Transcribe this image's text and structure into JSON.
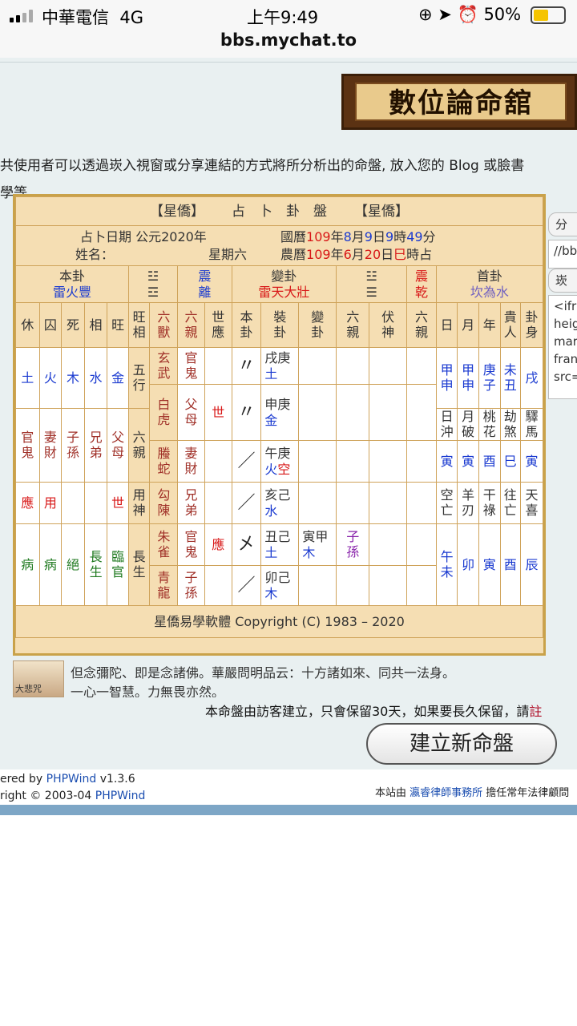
{
  "status": {
    "carrier": "中華電信",
    "network": "4G",
    "time": "上午9:49",
    "battery": "50%",
    "url": "bbs.mychat.to"
  },
  "banner": {
    "title": "數位論命舘"
  },
  "intro": {
    "line1": "共使用者可以透過崁入視窗或分享連結的方式將所分析出的命盤, 放入您的 Blog 或臉書",
    "line2": "學等."
  },
  "side": {
    "share_label": "分",
    "link_text": "//bb",
    "embed_label": "崁",
    "code_lines": [
      "<ifra",
      "heig",
      "mar",
      "fran",
      "src="
    ]
  },
  "chart": {
    "title_left": "【星僑】",
    "title_main": "占　卜　卦　盤",
    "title_right": "【星僑】",
    "date_label": "占卜日期 公元2020年",
    "name_label": "姓名：",
    "weekday": "星期六",
    "greg": {
      "p1": "國曆",
      "y": "109",
      "p2": "年",
      "m": "8",
      "p3": "月",
      "d": "9",
      "p4": "日",
      "h": "9",
      "p5": "時",
      "mi": "49",
      "p6": "分"
    },
    "lunar": {
      "p1": "農曆",
      "y": "109",
      "p2": "年",
      "m": "6",
      "p3": "月",
      "d": "20",
      "p4": "日",
      "h": "巳",
      "p5": "時占"
    },
    "ben_label": "本卦",
    "ben_name": "雷火豐",
    "tri1_top": "☳",
    "tri1_bot": "☲",
    "tri1_top_name": "震",
    "tri1_bot_name": "離",
    "bian_label": "變卦",
    "bian_name": "雷天大壯",
    "tri2_top": "☳",
    "tri2_bot": "☰",
    "tri2_top_name": "震",
    "tri2_bot_name": "乾",
    "shou_label": "首卦",
    "shou_name": "坎為水",
    "wang": [
      "休",
      "囚",
      "死",
      "相",
      "旺"
    ],
    "wang_label": "旺相",
    "wuxing": [
      "土",
      "火",
      "木",
      "水",
      "金"
    ],
    "wuxing_label": "五行",
    "liuqin_row": [
      "官鬼",
      "妻財",
      "子孫",
      "兄弟",
      "父母"
    ],
    "liuqin_label": "六親",
    "yong": [
      "應",
      "用",
      "",
      "",
      "世"
    ],
    "yong_label": "用神",
    "changsheng": [
      "病",
      "病",
      "絕",
      "長生",
      "臨官"
    ],
    "changsheng_label": "長生",
    "col_heads": [
      "六獸",
      "六親",
      "世應",
      "本卦",
      "裝卦",
      "變卦",
      "六親",
      "伏神",
      "六親"
    ],
    "lines": [
      {
        "shou": "玄武",
        "qin": "官鬼",
        "shi": "",
        "yao": "〃",
        "zhuang1": "戌庚",
        "zhuang2": "土",
        "bian1": "",
        "bian2": "",
        "q2": ""
      },
      {
        "shou": "白虎",
        "qin": "父母",
        "shi": "世",
        "yao": "〃",
        "zhuang1": "申庚",
        "zhuang2": "金",
        "bian1": "",
        "bian2": "",
        "q2": ""
      },
      {
        "shou": "螣蛇",
        "qin": "妻財",
        "shi": "",
        "yao": "／",
        "zhuang1": "午庚",
        "zhuang2": "火空",
        "bian1": "",
        "bian2": "",
        "q2": ""
      },
      {
        "shou": "勾陳",
        "qin": "兄弟",
        "shi": "",
        "yao": "／",
        "zhuang1": "亥己",
        "zhuang2": "水",
        "bian1": "",
        "bian2": "",
        "q2": ""
      },
      {
        "shou": "朱雀",
        "qin": "官鬼",
        "shi": "應",
        "yao": "㐅",
        "zhuang1": "丑己",
        "zhuang2": "土",
        "bian1": "寅甲",
        "bian2": "木",
        "q2": "子孫"
      },
      {
        "shou": "青龍",
        "qin": "子孫",
        "shi": "",
        "yao": "／",
        "zhuang1": "卯己",
        "zhuang2": "木",
        "bian1": "",
        "bian2": "",
        "q2": ""
      }
    ],
    "right_heads": [
      "日",
      "月",
      "年",
      "貴人",
      "卦身"
    ],
    "right_r1": [
      "甲申",
      "甲申",
      "庚子",
      "未丑",
      "戌"
    ],
    "right_h2": [
      "日沖",
      "月破",
      "桃花",
      "劫煞",
      "驛馬"
    ],
    "right_r2": [
      "寅",
      "寅",
      "酉",
      "巳",
      "寅"
    ],
    "right_h3": [
      "空亡",
      "羊刃",
      "干祿",
      "往亡",
      "天喜"
    ],
    "right_r3": [
      "午未",
      "卯",
      "寅",
      "酉",
      "辰"
    ],
    "copyright": "星僑易學軟體 Copyright (C) 1983 – 2020"
  },
  "quote": {
    "img_label": "大悲咒",
    "text": "但念彌陀、即是念諸佛。華嚴問明品云：十方諸如來、同共一法身。一心一智慧。力無畏亦然。"
  },
  "note": {
    "text": "本命盤由訪客建立，只會保留30天，如果要長久保留，請",
    "tail": "註"
  },
  "new_button": "建立新命盤",
  "footer": {
    "l1a": "ered by ",
    "l1b": "PHPWind",
    "l1c": " v1.3.6",
    "l2a": "right © 2003-04 ",
    "l2b": "PHPWind",
    "r1": "本站由 ",
    "r2": "瀛睿律師事務所",
    "r3": " 擔任常年法律顧問"
  }
}
